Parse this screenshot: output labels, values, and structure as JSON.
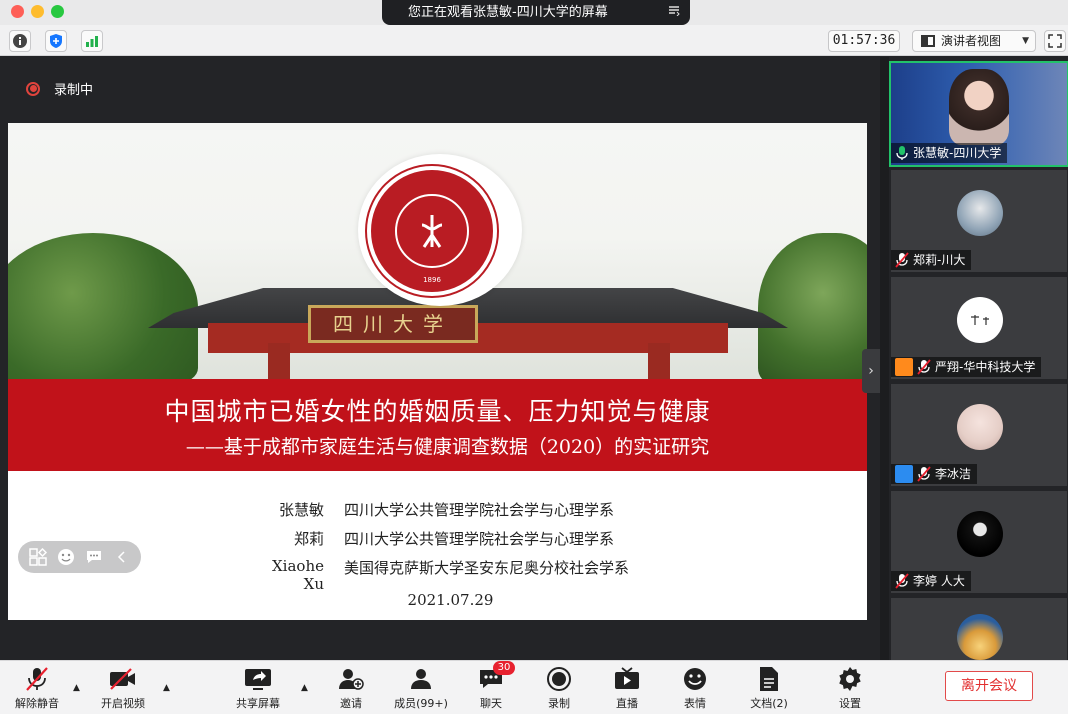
{
  "window": {
    "share_banner": "您正在观看张慧敏-四川大学的屏幕",
    "timer": "01:57:36",
    "view_mode": "演讲者视图"
  },
  "recording": {
    "label": "录制中"
  },
  "slide": {
    "plaque_text": "四川大学",
    "seal_year": "1896",
    "title": "中国城市已婚女性的婚姻质量、压力知觉与健康",
    "subtitle": "——基于成都市家庭生活与健康调查数据（2020）的实证研究",
    "authors": [
      {
        "name": "张慧敏",
        "affiliation": "四川大学公共管理学院社会学与心理学系"
      },
      {
        "name": "郑莉",
        "affiliation": "四川大学公共管理学院社会学与心理学系"
      },
      {
        "name": "Xiaohe Xu",
        "affiliation": "美国得克萨斯大学圣安东尼奥分校社会学系"
      }
    ],
    "date": "2021.07.29"
  },
  "participants": [
    {
      "name": "张慧敏-四川大学",
      "speaking": true
    },
    {
      "name": "郑莉-川大",
      "muted": true
    },
    {
      "name": "严翔-华中科技大学",
      "muted": true
    },
    {
      "name": "李冰洁",
      "muted": true
    },
    {
      "name": "李婷 人大",
      "muted": true
    },
    {
      "name": ""
    }
  ],
  "bottombar": {
    "unmute": "解除静音",
    "start_video": "开启视频",
    "share_screen": "共享屏幕",
    "invite": "邀请",
    "members": "成员(99+)",
    "chat": "聊天",
    "chat_badge": "30",
    "record": "录制",
    "live": "直播",
    "reactions": "表情",
    "docs": "文档(2)",
    "settings": "设置",
    "leave": "离开会议"
  },
  "colors": {
    "accent_red": "#c1121a",
    "speaking_green": "#22c26a",
    "leave_red": "#e22f2f"
  }
}
